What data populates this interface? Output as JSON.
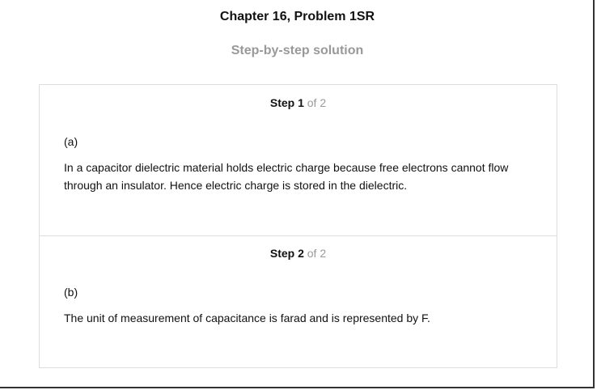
{
  "title": "Chapter 16, Problem 1SR",
  "subtitle": "Step-by-step solution",
  "steps": [
    {
      "label": "Step 1",
      "of": "of 2",
      "part": "(a)",
      "text": "In a capacitor dielectric material holds electric charge because free electrons cannot flow through an insulator. Hence electric charge is stored in the dielectric."
    },
    {
      "label": "Step 2",
      "of": "of 2",
      "part": "(b)",
      "text": "The unit of measurement of capacitance is farad and is represented by F."
    }
  ]
}
